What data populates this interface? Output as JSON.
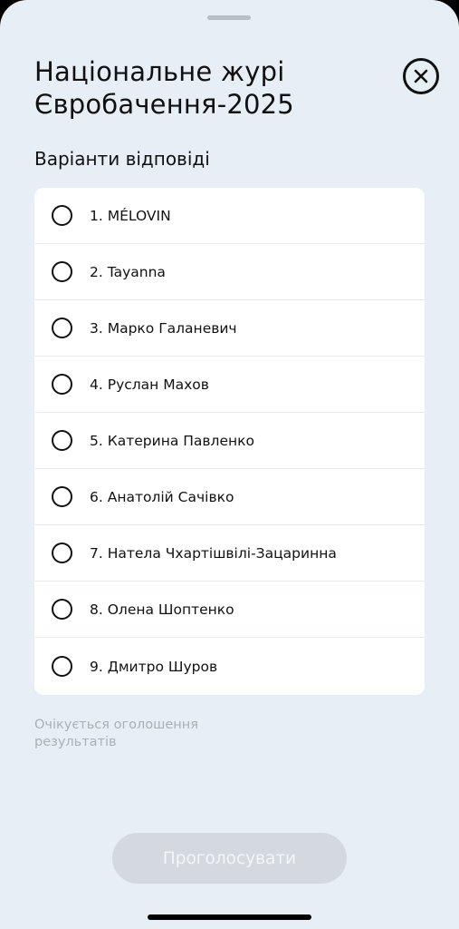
{
  "header": {
    "title": "Національне журі Євробачення-2025",
    "close_icon": "close-icon"
  },
  "section": {
    "title": "Варіанти відповіді"
  },
  "options": [
    {
      "label": "1. MÉLOVIN",
      "selected": false
    },
    {
      "label": "2. Tayanna",
      "selected": false
    },
    {
      "label": "3. Марко Галаневич",
      "selected": false
    },
    {
      "label": "4. Руслан Махов",
      "selected": false
    },
    {
      "label": "5. Катерина Павленко",
      "selected": false
    },
    {
      "label": "6. Анатолій Сачівко",
      "selected": false
    },
    {
      "label": "7. Натела Чхартішвілі-Зацаринна",
      "selected": false
    },
    {
      "label": "8. Олена Шоптенко",
      "selected": false
    },
    {
      "label": "9. Дмитро Шуров",
      "selected": false
    }
  ],
  "status": {
    "text": "Очікується оголошення результатів"
  },
  "footer": {
    "vote_label": "Проголосувати",
    "vote_enabled": false
  },
  "colors": {
    "background": "#e8eef5",
    "card": "#ffffff",
    "text": "#111111",
    "muted_text": "#a9b0b8",
    "button_disabled": "#d3d9de"
  }
}
